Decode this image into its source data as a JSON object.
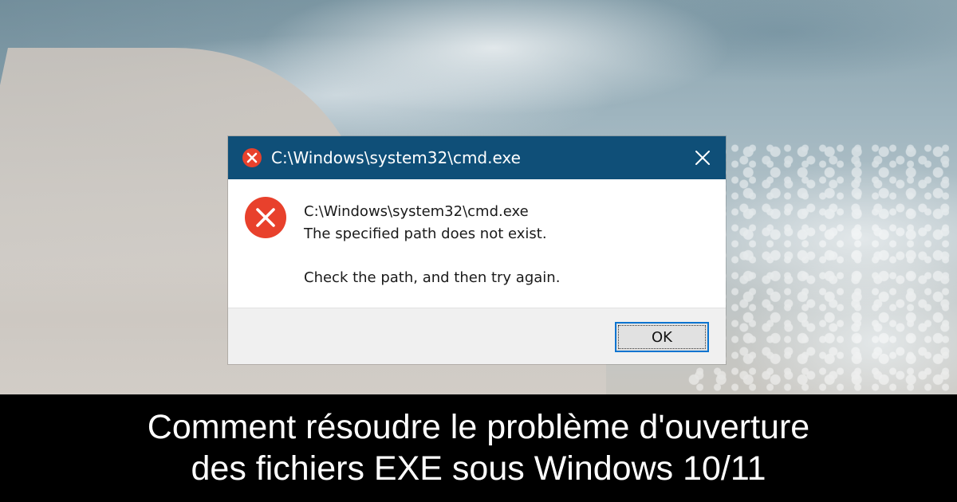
{
  "dialog": {
    "title": "C:\\Windows\\system32\\cmd.exe",
    "title_icon": "error-icon",
    "close_icon": "close-icon",
    "message_path": "C:\\Windows\\system32\\cmd.exe",
    "message_error": "The specified path does not exist.",
    "message_hint": "Check the path, and then try again.",
    "ok_label": "OK",
    "colors": {
      "titlebar": "#0f4f78",
      "error_red": "#e8412c",
      "footer": "#f0f0f0",
      "focus_border": "#0a74d0"
    }
  },
  "caption": {
    "line1": "Comment résoudre le problème d'ouverture",
    "line2": "des fichiers EXE sous Windows 10/11"
  }
}
